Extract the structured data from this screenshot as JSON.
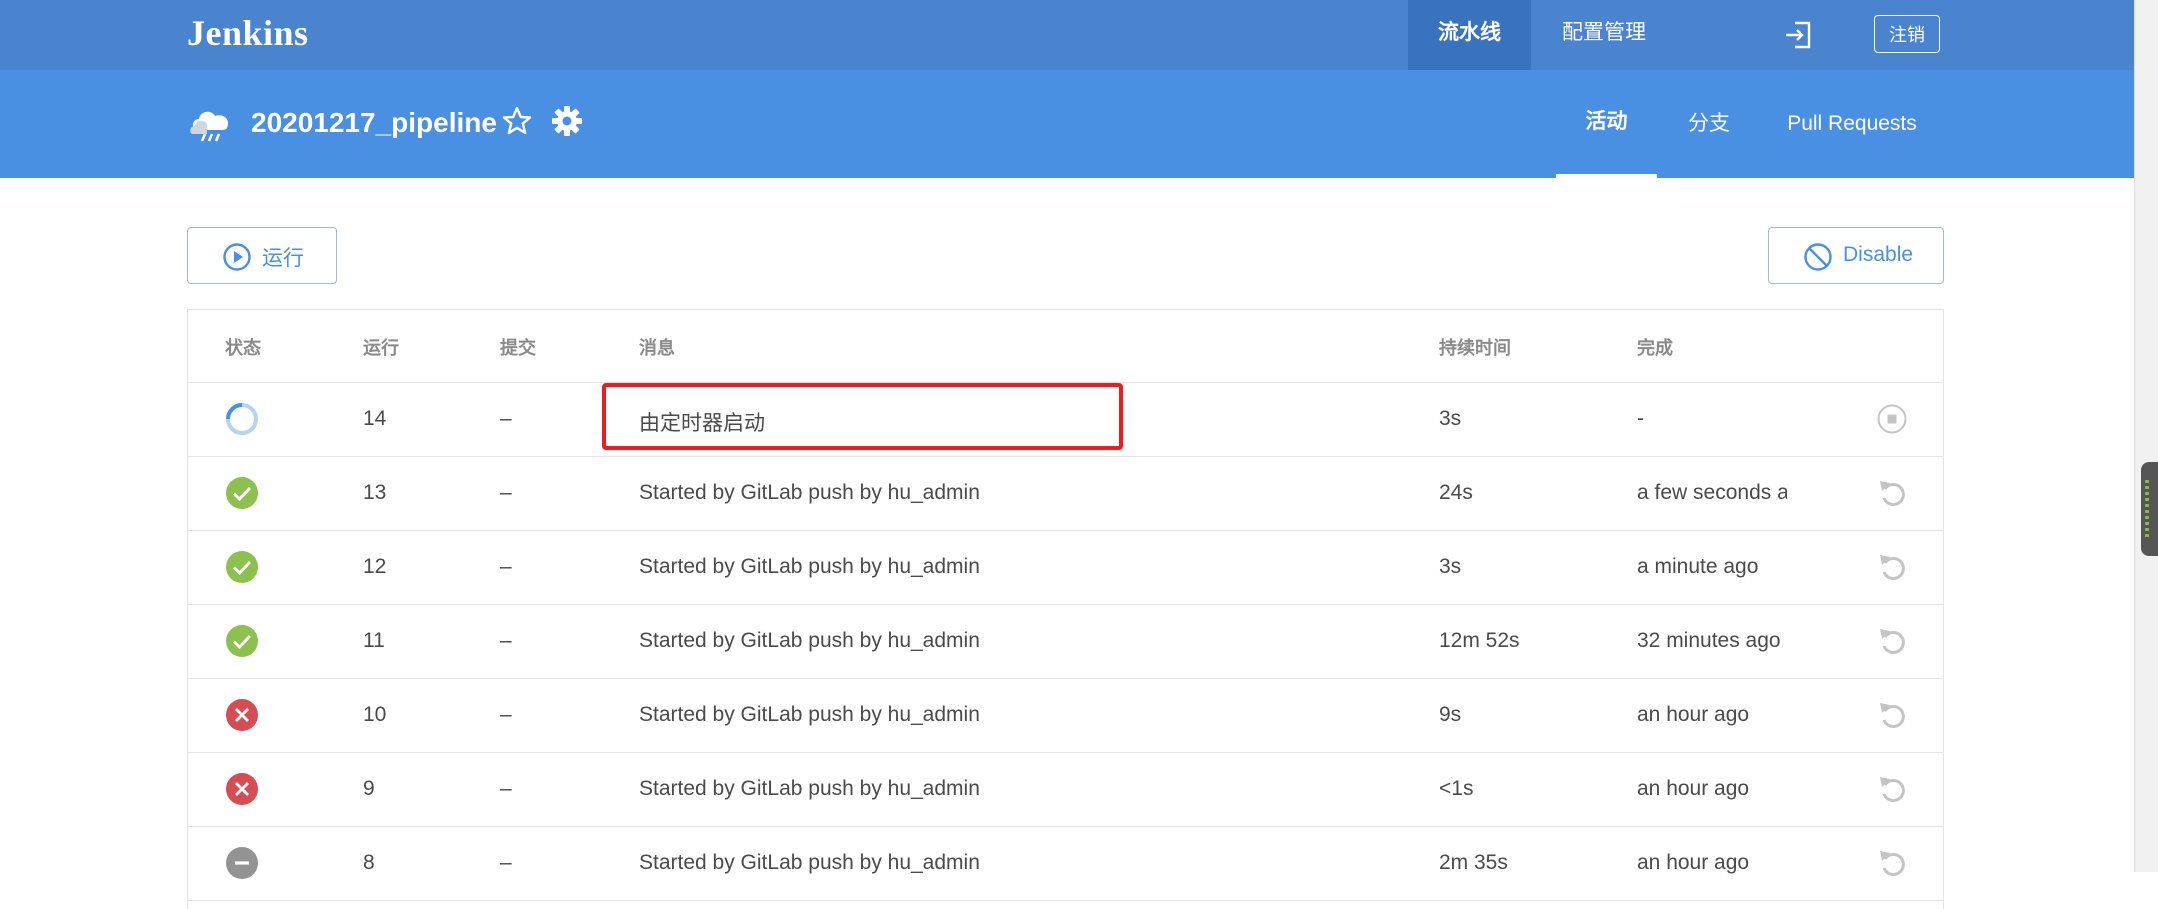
{
  "topbar": {
    "brand": "Jenkins",
    "nav": [
      "流水线",
      "配置管理"
    ],
    "logout_label": "注销"
  },
  "pipeline": {
    "name": "20201217_pipeline",
    "tabs": [
      "活动",
      "分支",
      "Pull Requests"
    ],
    "active_tab": "活动"
  },
  "actions": {
    "run_label": "运行",
    "disable_label": "Disable"
  },
  "table": {
    "headers": [
      "状态",
      "运行",
      "提交",
      "消息",
      "持续时间",
      "完成"
    ],
    "rows": [
      {
        "status": "running",
        "run": "14",
        "commit": "–",
        "message": "由定时器启动",
        "duration": "3s",
        "completed": "-",
        "action": "stop-icon"
      },
      {
        "status": "success",
        "run": "13",
        "commit": "–",
        "message": "Started by GitLab push by hu_admin",
        "duration": "24s",
        "completed": "a few seconds ag",
        "action": "replay-icon"
      },
      {
        "status": "success",
        "run": "12",
        "commit": "–",
        "message": "Started by GitLab push by hu_admin",
        "duration": "3s",
        "completed": "a minute ago",
        "action": "replay-icon"
      },
      {
        "status": "success",
        "run": "11",
        "commit": "–",
        "message": "Started by GitLab push by hu_admin",
        "duration": "12m 52s",
        "completed": "32 minutes ago",
        "action": "replay-icon"
      },
      {
        "status": "failed",
        "run": "10",
        "commit": "–",
        "message": "Started by GitLab push by hu_admin",
        "duration": "9s",
        "completed": "an hour ago",
        "action": "replay-icon"
      },
      {
        "status": "failed",
        "run": "9",
        "commit": "–",
        "message": "Started by GitLab push by hu_admin",
        "duration": "<1s",
        "completed": "an hour ago",
        "action": "replay-icon"
      },
      {
        "status": "aborted",
        "run": "8",
        "commit": "–",
        "message": "Started by GitLab push by hu_admin",
        "duration": "2m 35s",
        "completed": "an hour ago",
        "action": "replay-icon"
      }
    ]
  },
  "colors": {
    "topbar": "#4a84cf",
    "subheader": "#4a90e2",
    "success": "#8cc04f",
    "failed": "#d54c53",
    "aborted": "#949393",
    "running": "#4a90e2",
    "highlight": "#ee1c1c"
  }
}
